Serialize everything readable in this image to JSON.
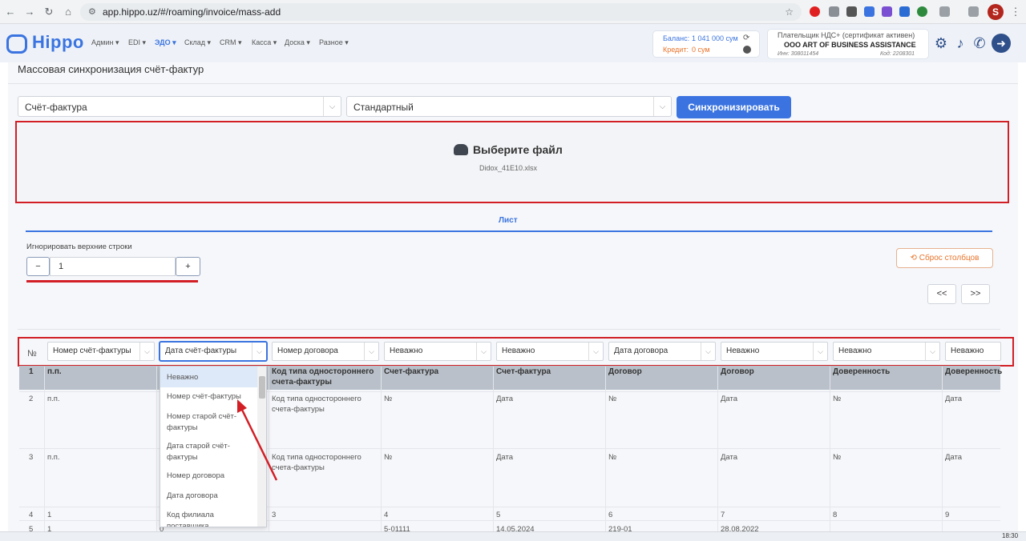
{
  "browser": {
    "url": "app.hippo.uz/#/roaming/invoice/mass-add",
    "avatar_letter": "S"
  },
  "app": {
    "logo": "Hippo",
    "menu": [
      "Админ ▾",
      "EDI ▾",
      "ЭДО ▾",
      "Склад ▾",
      "CRM ▾",
      "Касса ▾",
      "Доска ▾",
      "Разное ▾"
    ],
    "balance_label": "Баланс:",
    "balance_value": "1 041 000 сум",
    "credit_label": "Кредит:",
    "credit_value": "0 сум",
    "payer_status": "Плательщик НДС+ (сертификат активен)",
    "company": "OOO ART OF BUSINESS ASSISTANCE",
    "inn": "Инн: 308011454",
    "code": "Код: 2208301"
  },
  "page": {
    "title": "Массовая синхронизация счёт-фактур",
    "doc_type": "Счёт-фактура",
    "template": "Стандартный",
    "sync_button": "Синхронизировать",
    "upload_title": "Выберите файл",
    "file_name": "Didox_41E10.xlsx",
    "sheet_tab": "Лист",
    "ignore_label": "Игнорировать верхние строки",
    "ignore_value": "1",
    "minus": "−",
    "plus": "+",
    "reset_button": "Сброс столбцов",
    "prev": "<<",
    "next": ">>",
    "num_header": "№"
  },
  "column_selects": [
    "Номер счёт-фактуры",
    "Дата счёт-фактуры",
    "Номер договора",
    "Неважно",
    "Неважно",
    "Дата договора",
    "Неважно",
    "Неважно",
    "Неважно"
  ],
  "table": {
    "header": {
      "num": "1",
      "cells": [
        "п.п.",
        "",
        "Код типа одностороннего счета-фактуры",
        "Счет-фактура",
        "Счет-фактура",
        "Договор",
        "Договор",
        "Доверенность",
        "Доверенность"
      ]
    },
    "rows": [
      {
        "num": "2",
        "cells": [
          "п.п.",
          "",
          "Код типа одностороннего счета-фактуры",
          "№",
          "Дата",
          "№",
          "Дата",
          "№",
          "Дата"
        ]
      },
      {
        "num": "3",
        "cells": [
          "п.п.",
          "",
          "Код типа одностороннего счета-фактуры",
          "№",
          "Дата",
          "№",
          "Дата",
          "№",
          "Дата"
        ]
      },
      {
        "num": "4",
        "cells": [
          "1",
          "",
          "3",
          "4",
          "5",
          "6",
          "7",
          "8",
          "9"
        ]
      },
      {
        "num": "5",
        "cells": [
          "1",
          "0",
          "",
          "5-01111",
          "14.05.2024",
          "219-01",
          "28.08.2022",
          "",
          ""
        ]
      }
    ]
  },
  "dropdown": {
    "options": [
      "Неважно",
      "Номер счёт-фактуры",
      "Номер старой счёт-фактуры",
      "Дата старой счёт-фактуры",
      "Номер договора",
      "Дата договора",
      "Код филиала поставщика"
    ]
  },
  "taskbar": {
    "time": "18:30"
  },
  "colors": {
    "accent": "#3b74e0",
    "red": "#d21f26",
    "orange": "#e8732a"
  }
}
